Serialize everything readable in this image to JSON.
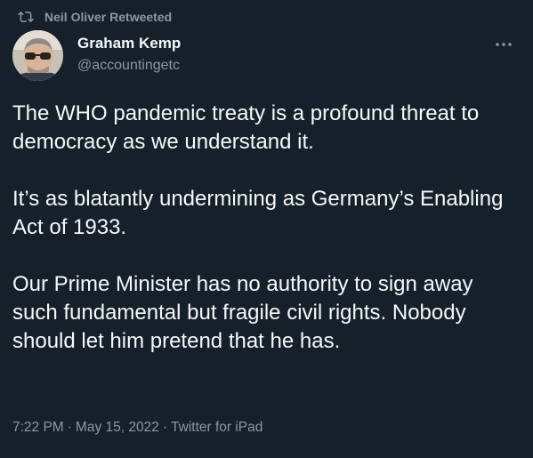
{
  "retweet": {
    "label": "Neil Oliver Retweeted",
    "icon": "retweet-icon"
  },
  "author": {
    "display_name": "Graham Kemp",
    "handle": "@accountingetc",
    "avatar_icon": "avatar-photo"
  },
  "more_icon": "more-options-icon",
  "tweet": {
    "paragraphs": [
      "The WHO pandemic treaty is a profound threat to democracy as we understand it.",
      "It’s as blatantly undermining as Germany’s Enabling Act of 1933.",
      "Our Prime Minister has no authority to sign away such fundamental but fragile civil rights. Nobody should let him pretend that he has."
    ]
  },
  "meta": {
    "time": "7:22 PM",
    "date": "May 15, 2022",
    "source": "Twitter for iPad",
    "separator": "·"
  },
  "colors": {
    "background": "#15202b",
    "text": "#f7f9f9",
    "secondary": "#8b98a5"
  }
}
